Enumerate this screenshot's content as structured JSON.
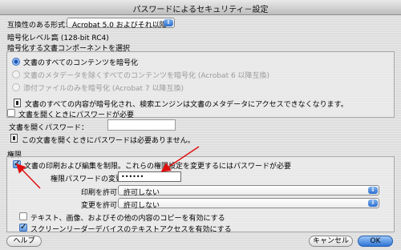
{
  "window": {
    "title": "パスワードによるセキュリティ－設定"
  },
  "compat": {
    "label": "互換性のある形式：",
    "value": "Acrobat 5.0 およびそれ以降"
  },
  "encryption_level": {
    "label": "暗号化レベル：",
    "value": "高 (128-bit RC4)"
  },
  "component_group": {
    "title": "暗号化する文書コンポーネントを選択",
    "options": [
      {
        "label": "文書のすべてのコンテンツを暗号化",
        "selected": true,
        "enabled": true
      },
      {
        "label": "文書のメタデータを除くすべてのコンテンツを暗号化 (Acrobat 6 以降互換)",
        "selected": false,
        "enabled": false
      },
      {
        "label": "添付ファイルのみを暗号化 (Acrobat 7 以降互換)",
        "selected": false,
        "enabled": false
      }
    ],
    "info": "文書のすべての内容が暗号化され、検索エンジンは文書のメタデータにアクセスできなくなります。"
  },
  "open_password": {
    "checkbox_label": "文書を開くときにパスワードが必要",
    "checked": false,
    "field_label": "文書を開くパスワード：",
    "info": "この文書を開くときにパスワードは必要ありません。"
  },
  "permissions": {
    "title": "権限",
    "restrict_label": "文書の印刷および編集を制限。これらの権限設定を変更するにはパスワードが必要",
    "restrict_checked": true,
    "password_label": "権限パスワードの変更：",
    "password_value": "••••••",
    "print_label": "印刷を許可：",
    "print_value": "許可しない",
    "change_label": "変更を許可：",
    "change_value": "許可しない",
    "copy_label": "テキスト、画像、およびその他の内容のコピーを有効にする",
    "copy_checked": false,
    "screenreader_label": "スクリーンリーダーデバイスのテキストアクセスを有効にする",
    "screenreader_checked": true
  },
  "buttons": {
    "help": "ヘルプ",
    "cancel": "キャンセル",
    "ok": "OK"
  },
  "colors": {
    "annotation_arrow": "#e01010",
    "accent": "#2f73d6"
  }
}
